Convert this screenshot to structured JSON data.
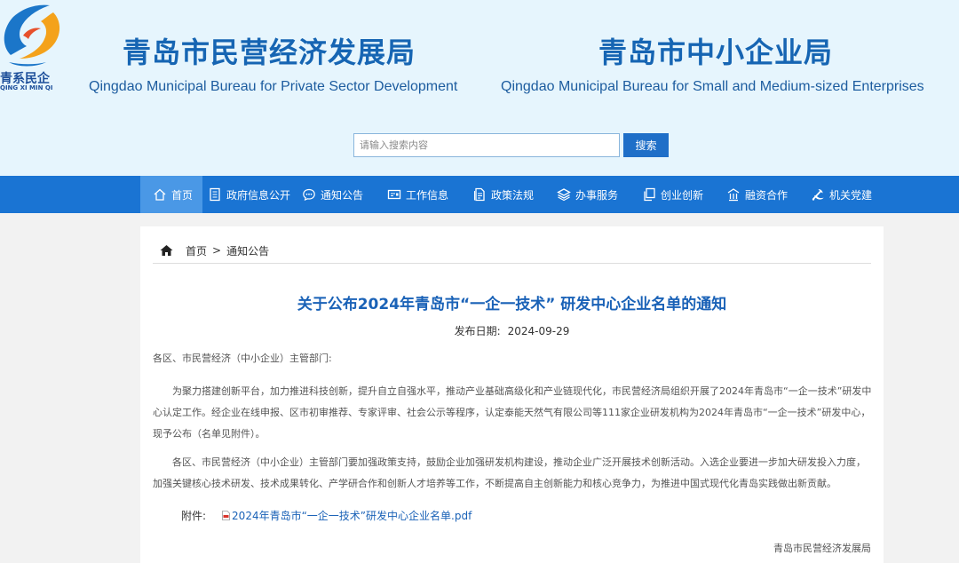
{
  "header": {
    "logo_cn": "青系民企",
    "logo_en": "QING XI MIN QI",
    "bureau1_cn": "青岛市民营经济发展局",
    "bureau1_en": "Qingdao Municipal Bureau for Private Sector Development",
    "bureau2_cn": "青岛市中小企业局",
    "bureau2_en": "Qingdao Municipal Bureau for Small and Medium-sized Enterprises"
  },
  "search": {
    "placeholder": "请输入搜索内容",
    "button": "搜索"
  },
  "nav": {
    "items": [
      {
        "label": "首页",
        "icon": "home-icon"
      },
      {
        "label": "政府信息公开",
        "icon": "document-icon"
      },
      {
        "label": "通知公告",
        "icon": "chat-icon"
      },
      {
        "label": "工作信息",
        "icon": "id-card-icon"
      },
      {
        "label": "政策法规",
        "icon": "files-icon"
      },
      {
        "label": "办事服务",
        "icon": "layers-icon"
      },
      {
        "label": "创业创新",
        "icon": "copy-icon"
      },
      {
        "label": "融资合作",
        "icon": "building-icon"
      },
      {
        "label": "机关党建",
        "icon": "party-emblem-icon"
      }
    ]
  },
  "breadcrumb": {
    "home": "首页",
    "separator": ">",
    "current": "通知公告"
  },
  "article": {
    "title": "关于公布2024年青岛市“一企一技术” 研发中心企业名单的通知",
    "date_label": "发布日期:",
    "date": "2024-09-29",
    "greeting": "各区、市民营经济（中小企业）主管部门:",
    "paragraph1": "为聚力搭建创新平台，加力推进科技创新，提升自立自强水平，推动产业基础高级化和产业链现代化，市民营经济局组织开展了2024年青岛市“一企一技术”研发中心认定工作。经企业在线申报、区市初审推荐、专家评审、社会公示等程序，认定泰能天然气有限公司等111家企业研发机构为2024年青岛市“一企一技术”研发中心，现予公布（名单见附件）。",
    "paragraph2": "各区、市民营经济（中小企业）主管部门要加强政策支持，鼓励企业加强研发机构建设，推动企业广泛开展技术创新活动。入选企业要进一步加大研发投入力度，加强关键核心技术研发、技术成果转化、产学研合作和创新人才培养等工作，不断提高自主创新能力和核心竞争力，为推进中国式现代化青岛实践做出新贡献。",
    "attachment_label": "附件:",
    "attachment_file": "2024年青岛市“一企一技术”研发中心企业名单.pdf",
    "signature": "青岛市民营经济发展局"
  },
  "colors": {
    "nav_bg": "#1a74d3",
    "nav_active": "#4a98e6",
    "title_blue": "#1665b3",
    "header_bg": "#e6f5fd"
  }
}
